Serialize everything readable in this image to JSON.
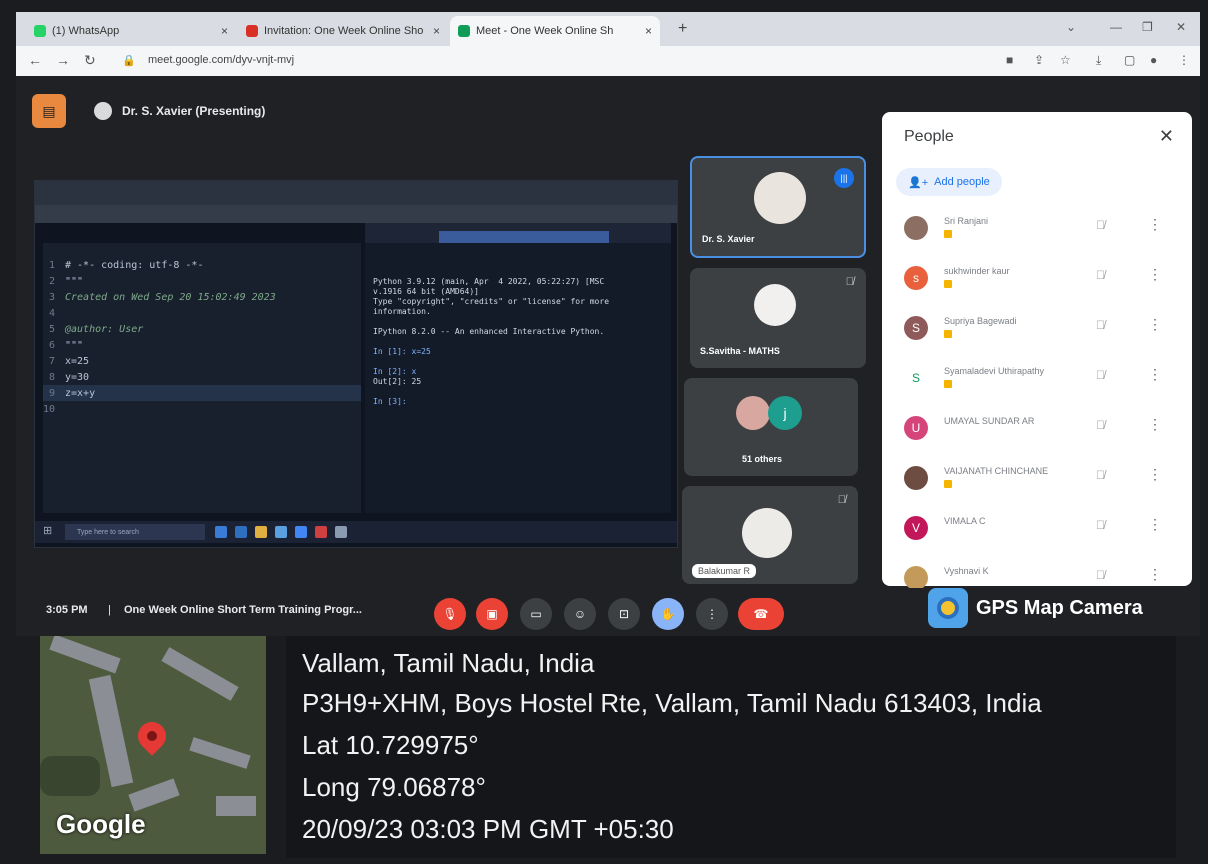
{
  "browser": {
    "tabs": [
      {
        "label": "(1) WhatsApp",
        "color": "#25d366"
      },
      {
        "label": "Invitation: One Week Online Sho",
        "color": "#d93025"
      },
      {
        "label": "Meet - One Week Online Sh",
        "color": "#0f9d58"
      }
    ],
    "new_tab": "+",
    "url": "meet.google.com/dyv-vnjt-mvj"
  },
  "meet": {
    "presenter_label": "Dr. S. Xavier (Presenting)",
    "time": "3:05 PM",
    "separator": "|",
    "meeting_title": "One Week Online Short Term Training Progr...",
    "tiles": [
      {
        "name": "Dr. S. Xavier"
      },
      {
        "name": "S.Savitha - MATHS"
      },
      {
        "name": "51 others",
        "avatar_letter": "j"
      },
      {
        "name": "Balakumar R"
      }
    ],
    "accent_color": "#1a73e8",
    "danger_color": "#ea4335"
  },
  "shared_screen": {
    "code_lines": [
      {
        "n": "1",
        "t": "# -*- coding: utf-8 -*-",
        "comment": false
      },
      {
        "n": "2",
        "t": "\"\"\"",
        "comment": false
      },
      {
        "n": "3",
        "t": "Created on Wed Sep 20 15:02:49 2023",
        "comment": true
      },
      {
        "n": "4",
        "t": "",
        "comment": false
      },
      {
        "n": "5",
        "t": "@author: User",
        "comment": true
      },
      {
        "n": "6",
        "t": "\"\"\"",
        "comment": false
      },
      {
        "n": "7",
        "t": "x=25",
        "comment": false
      },
      {
        "n": "8",
        "t": "y=30",
        "comment": false
      },
      {
        "n": "9",
        "t": "z=x+y",
        "comment": false
      },
      {
        "n": "10",
        "t": "",
        "comment": false
      }
    ],
    "console_lines": [
      "Python 3.9.12 (main, Apr  4 2022, 05:22:27) [MSC",
      "v.1916 64 bit (AMD64)]",
      "Type \"copyright\", \"credits\" or \"license\" for more",
      "information.",
      "",
      "IPython 8.2.0 -- An enhanced Interactive Python.",
      "",
      "In [1]: x=25",
      "",
      "In [2]: x",
      "Out[2]: 25",
      "",
      "In [3]:"
    ],
    "taskbar_search": "Type here to search"
  },
  "people_panel": {
    "title": "People",
    "add_people": "Add people",
    "participants": [
      {
        "name": "Sri Ranjani",
        "letter": "",
        "color": "#8d6e63",
        "host": true
      },
      {
        "name": "sukhwinder kaur",
        "letter": "s",
        "color": "#e8603c",
        "host": true
      },
      {
        "name": "Supriya Bagewadi",
        "letter": "S",
        "color": "#8e5a5a",
        "host": true
      },
      {
        "name": "Syamaladevi Uthirapathy",
        "letter": "S",
        "color": "#ffffff",
        "host": true
      },
      {
        "name": "UMAYAL SUNDAR AR",
        "letter": "U",
        "color": "#d6457a",
        "host": false
      },
      {
        "name": "VAIJANATH CHINCHANE",
        "letter": "",
        "color": "#6d4c41",
        "host": true
      },
      {
        "name": "VIMALA C",
        "letter": "V",
        "color": "#c2185b",
        "host": false
      },
      {
        "name": "Vyshnavi K",
        "letter": "",
        "color": "#c49a5a",
        "host": false
      }
    ]
  },
  "gps": {
    "app_name": "GPS Map Camera",
    "location": "Vallam, Tamil Nadu, India",
    "address": "P3H9+XHM, Boys Hostel Rte, Vallam, Tamil Nadu 613403, India",
    "lat": "Lat 10.729975°",
    "long": "Long 79.06878°",
    "datetime": "20/09/23 03:03 PM GMT +05:30",
    "map_brand": "Google"
  }
}
